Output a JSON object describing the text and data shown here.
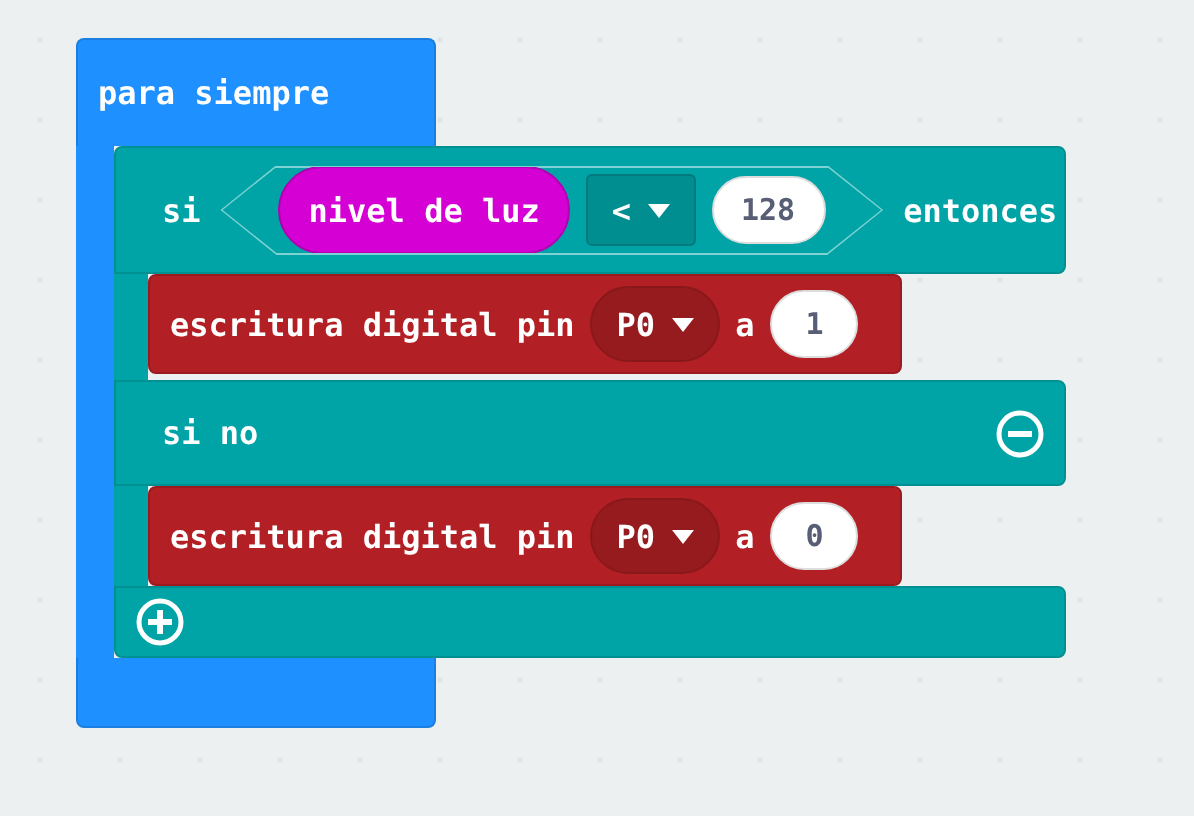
{
  "event_block": {
    "label": "para siempre"
  },
  "if_block": {
    "if_label": "si",
    "condition": {
      "sensor": "nivel de luz",
      "operator": "<",
      "value": "128"
    },
    "then_label": "entonces",
    "then_statements": [
      {
        "kind": "digital_write",
        "label": "escritura digital pin",
        "pin": "P0",
        "to_label": "a",
        "value": "1"
      }
    ],
    "else_label": "si no",
    "else_statements": [
      {
        "kind": "digital_write",
        "label": "escritura digital pin",
        "pin": "P0",
        "to_label": "a",
        "value": "0"
      }
    ]
  }
}
